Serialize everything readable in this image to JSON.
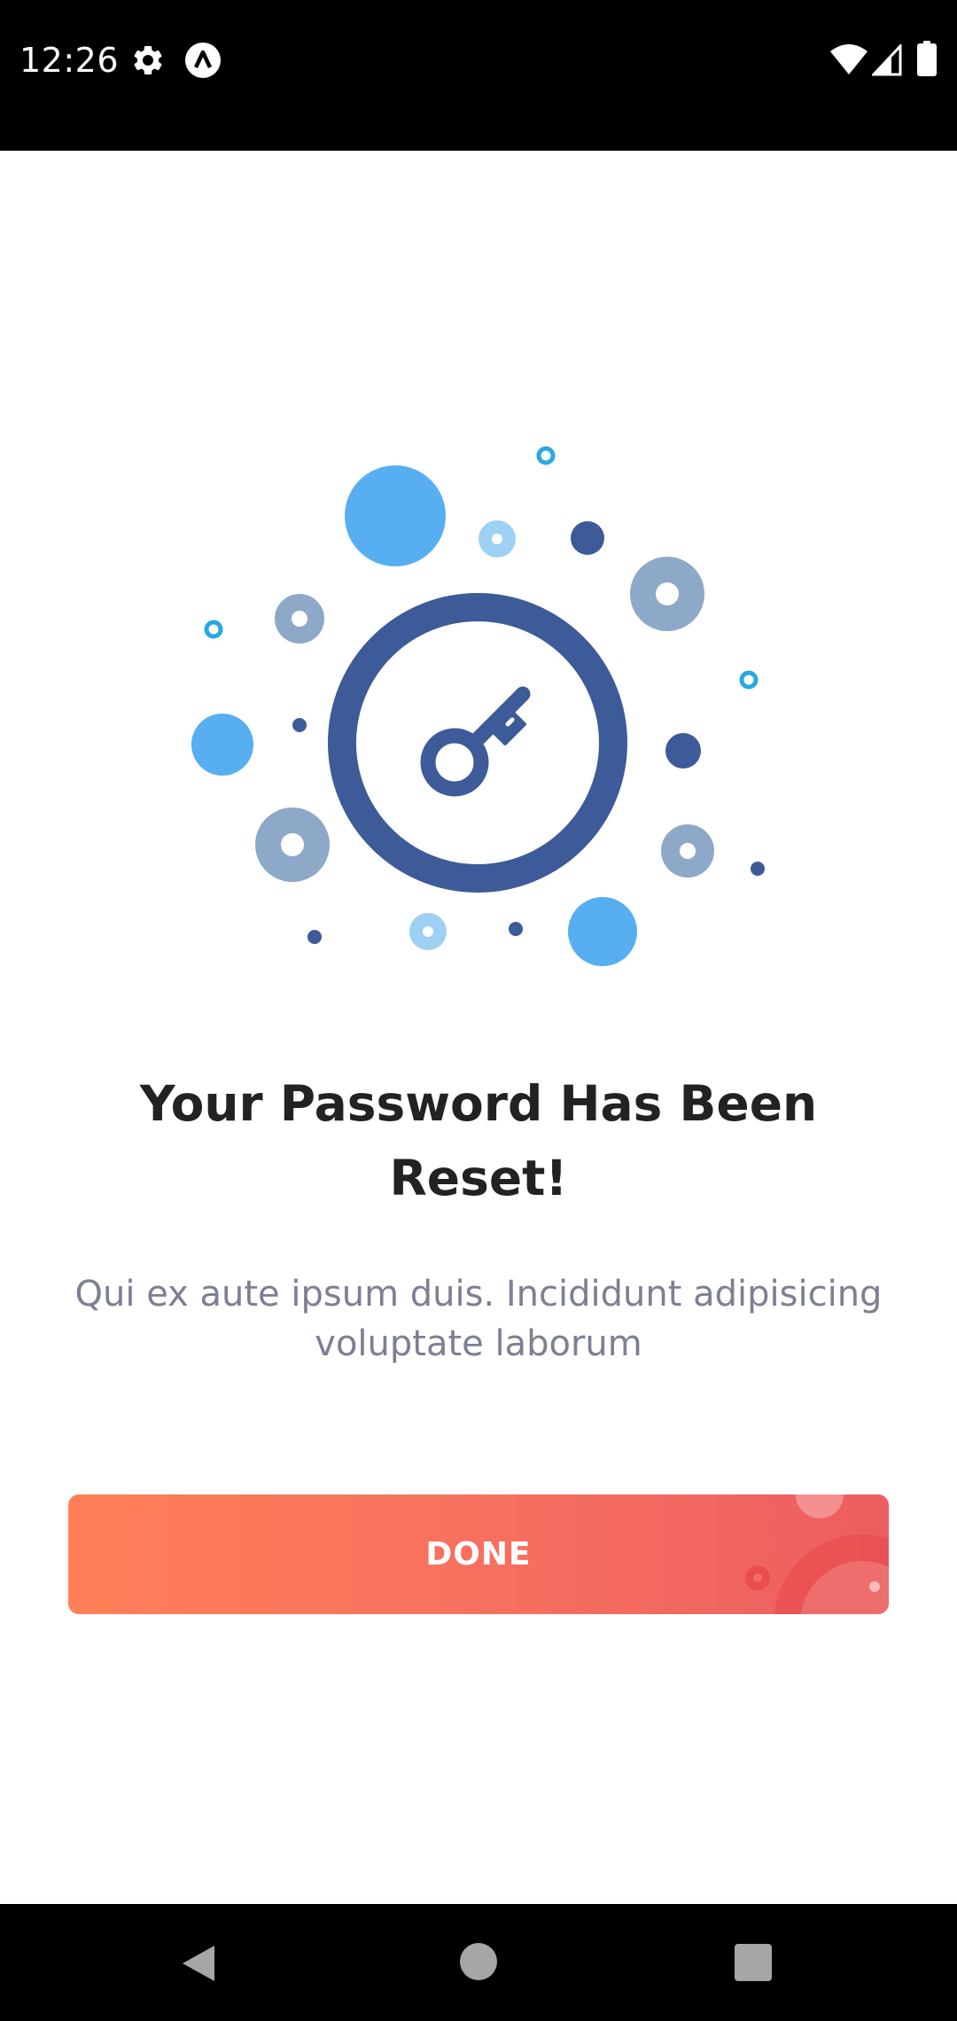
{
  "status_bar": {
    "time": "12:26",
    "icons": [
      "gear-icon",
      "app-notification-icon",
      "wifi-icon",
      "signal-icon",
      "battery-icon"
    ]
  },
  "illustration": {
    "icon": "key-icon",
    "colors": {
      "ring": "#3d5a99",
      "bright_blue": "#57aef0",
      "light_blue": "#9dd0f2",
      "muted_blue": "#8ea8c8",
      "dark_blue": "#3d5a99",
      "cyan": "#29a8e0"
    }
  },
  "main": {
    "title": "Your Password Has Been Reset!",
    "subtitle": "Qui ex aute ipsum duis. Incididunt adipisicing voluptate laborum",
    "done_button": {
      "label": "DONE",
      "gradient_start": "#ff7f58",
      "gradient_end": "#ed5d61"
    }
  },
  "nav_bar": {
    "buttons": [
      "back-icon",
      "home-icon",
      "recents-icon"
    ]
  }
}
